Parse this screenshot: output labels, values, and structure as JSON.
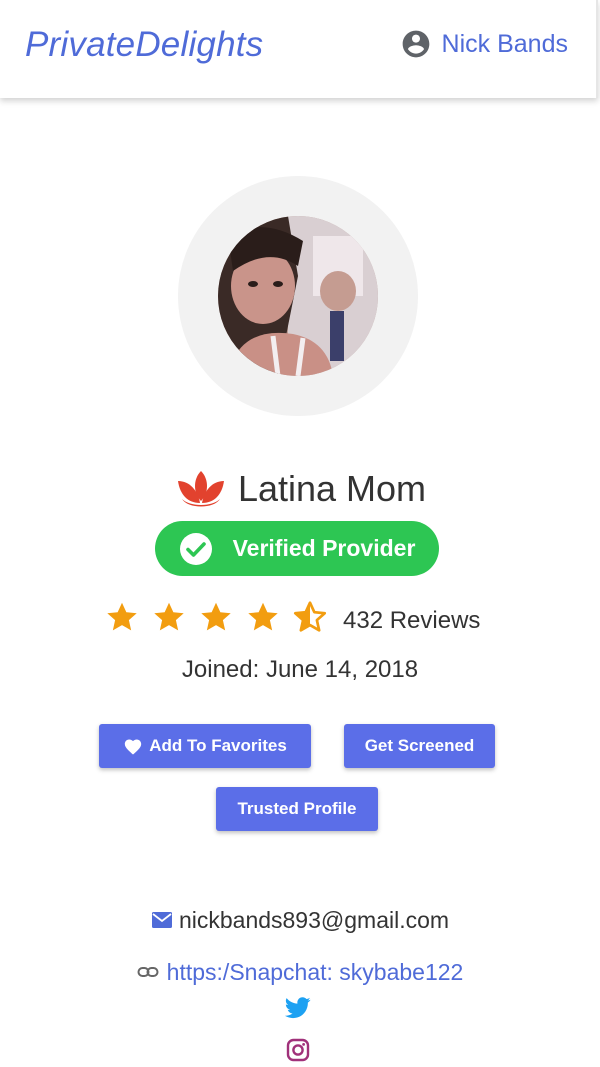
{
  "header": {
    "brand": "PrivateDelights",
    "user_name": "Nick Bands"
  },
  "profile": {
    "name": "Latina Mom",
    "verified_label": "Verified Provider",
    "rating": 4.5,
    "reviews_text": "432 Reviews",
    "joined_text": "Joined: June 14, 2018"
  },
  "actions": {
    "favorites_label": "Add To Favorites",
    "screened_label": "Get Screened",
    "trusted_label": "Trusted Profile"
  },
  "contact": {
    "email": "nickbands893@gmail.com",
    "link": "https:/Snapchat: skybabe122"
  },
  "icons": {
    "user": "account-circle-icon",
    "lotus": "lotus-icon",
    "check": "check-circle-icon",
    "star": "star-icon",
    "heart": "heart-icon",
    "mail": "mail-icon",
    "link": "link-icon",
    "twitter": "twitter-icon",
    "instagram": "instagram-icon"
  },
  "colors": {
    "brand_blue": "#4f6bd8",
    "button_blue": "#5b6ee8",
    "verified_green": "#2dc653",
    "star_orange": "#f29d10",
    "lotus_red": "#e2422e",
    "twitter_blue": "#1da1f2",
    "instagram_purple": "#a0317a"
  }
}
